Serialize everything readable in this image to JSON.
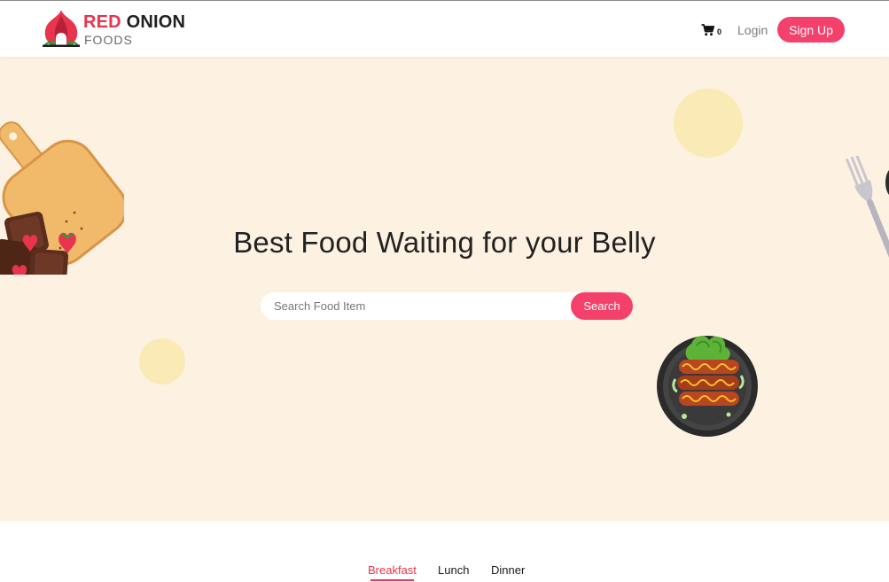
{
  "brand": {
    "name_red": "RED",
    "name_dark": "ONION",
    "subtitle": "FOODS"
  },
  "header": {
    "cart_icon": "shopping-cart-icon",
    "cart_count": "0",
    "login_label": "Login",
    "signup_label": "Sign Up"
  },
  "hero": {
    "title": "Best Food Waiting for your Belly",
    "search": {
      "placeholder": "Search Food Item",
      "value": "",
      "button_label": "Search"
    }
  },
  "tabs": [
    {
      "label": "Breakfast",
      "active": true
    },
    {
      "label": "Lunch",
      "active": false
    },
    {
      "label": "Dinner",
      "active": false
    }
  ],
  "colors": {
    "accent": "#f4416c",
    "brand_red": "#e8344d",
    "hero_background": "#fdf2e1",
    "deco_circle": "#faeab5"
  }
}
